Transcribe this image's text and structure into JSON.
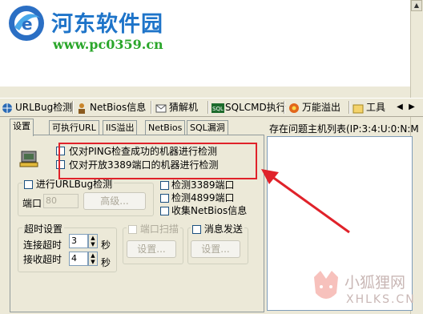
{
  "logo": {
    "title": "河东软件园",
    "url": "www.pc0359.cn"
  },
  "toolbar": {
    "items": [
      {
        "label": "URLBug检测",
        "icon": "globe-icon"
      },
      {
        "label": "NetBios信息",
        "icon": "user-icon"
      },
      {
        "label": "猜解机",
        "icon": "mail-icon"
      },
      {
        "label": "SQLCMD执行",
        "icon": "sql-icon"
      },
      {
        "label": "万能溢出",
        "icon": "gear-icon"
      },
      {
        "label": "工具",
        "icon": "folder-icon"
      }
    ]
  },
  "tabs": [
    "设置",
    "可执行URL",
    "IIS溢出",
    "NetBios",
    "SQL漏洞"
  ],
  "right": {
    "label": "存在问题主机列表(IP:3:4:U:0:N:M"
  },
  "panel": {
    "ping_check": "仅对PING检查成功的机器进行检测",
    "port_check": "仅对开放3389端口的机器进行检测",
    "urlbug_label": "进行URLBug检测",
    "port_label": "端口",
    "port_value": "80",
    "advanced_button": "高级...",
    "detect_3389": "检测3389端口",
    "detect_4899": "检测4899端口",
    "collect_netbios": "收集NetBios信息",
    "timeout_group": "超时设置",
    "connect_timeout": "连接超时",
    "receive_timeout": "接收超时",
    "connect_value": "3",
    "receive_value": "4",
    "seconds": "秒",
    "port_scan": "端口扫描",
    "message_send": "消息发送",
    "settings_button": "设置..."
  },
  "watermark": {
    "name": "小狐狸网",
    "domain": "XHLKS.CN"
  },
  "colors": {
    "logo_blue": "#1e74c9",
    "logo_green": "#2aa62a",
    "annotation_red": "#e0222a"
  }
}
